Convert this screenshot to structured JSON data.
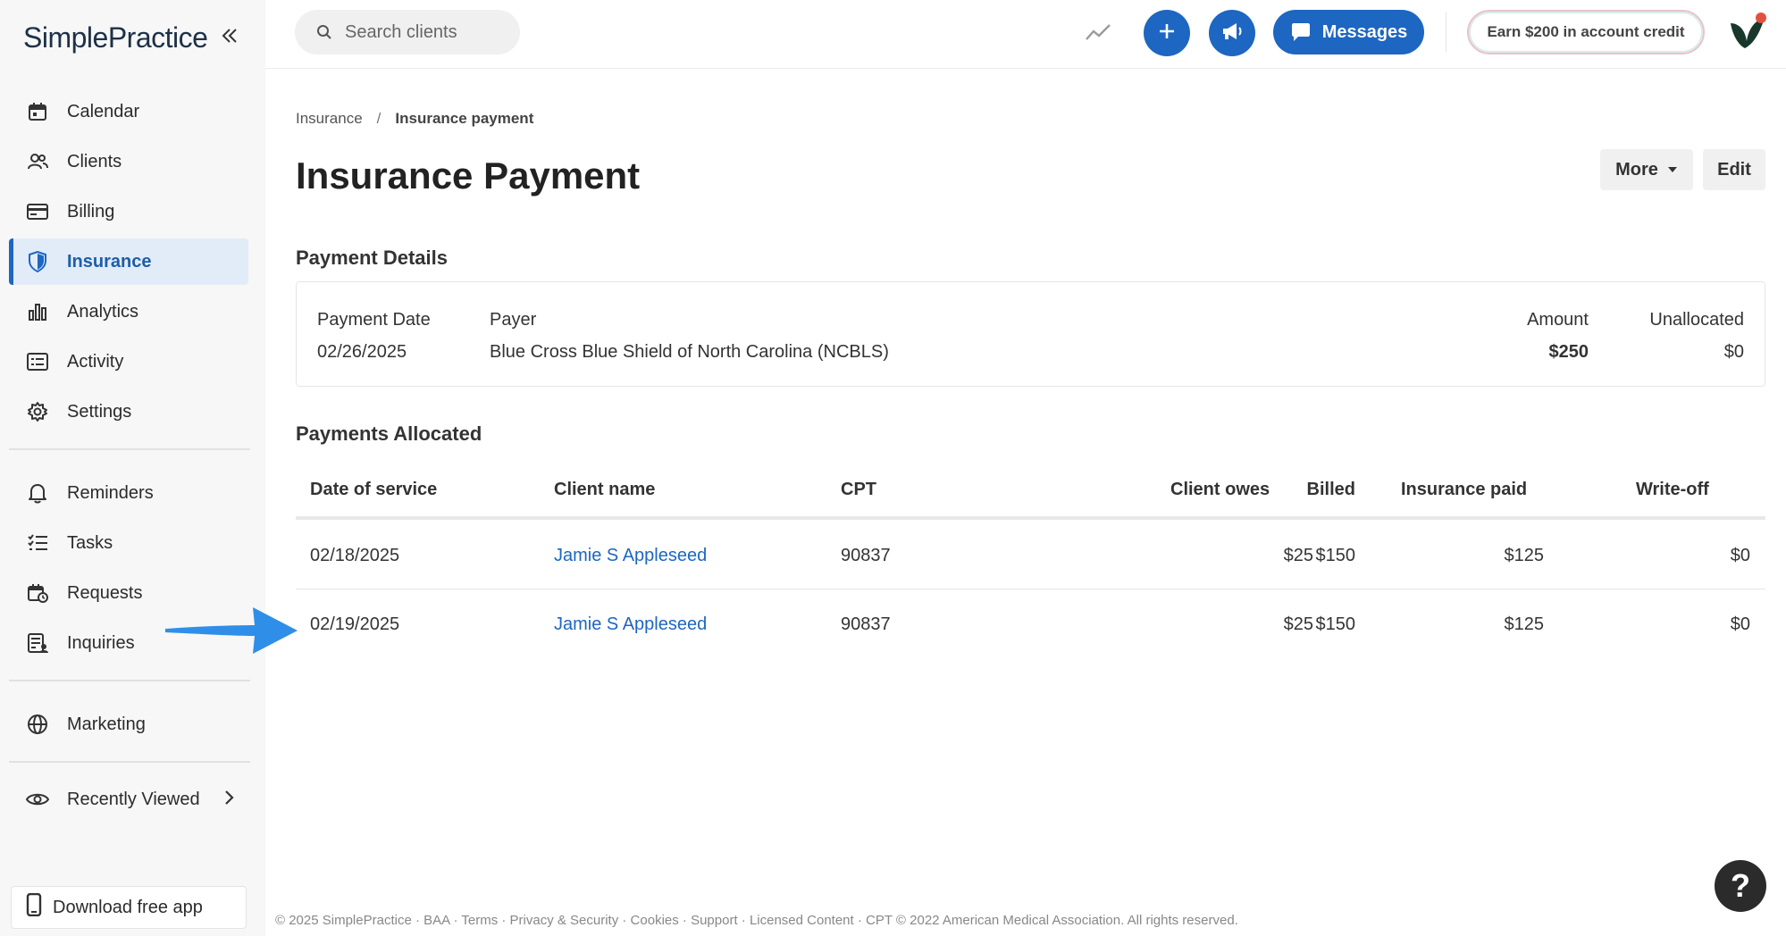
{
  "app": {
    "logo_text": "SimplePractice"
  },
  "sidebar": {
    "primary": [
      {
        "label": "Calendar",
        "icon": "calendar-icon",
        "active": false
      },
      {
        "label": "Clients",
        "icon": "clients-icon",
        "active": false
      },
      {
        "label": "Billing",
        "icon": "billing-icon",
        "active": false
      },
      {
        "label": "Insurance",
        "icon": "shield-icon",
        "active": true
      },
      {
        "label": "Analytics",
        "icon": "bar-chart-icon",
        "active": false
      },
      {
        "label": "Activity",
        "icon": "list-icon",
        "active": false
      },
      {
        "label": "Settings",
        "icon": "gear-icon",
        "active": false
      }
    ],
    "secondary": [
      {
        "label": "Reminders",
        "icon": "bell-icon"
      },
      {
        "label": "Tasks",
        "icon": "tasks-icon"
      },
      {
        "label": "Requests",
        "icon": "requests-icon"
      },
      {
        "label": "Inquiries",
        "icon": "inquiries-icon"
      }
    ],
    "marketing": {
      "label": "Marketing",
      "icon": "globe-icon"
    },
    "recently_viewed": {
      "label": "Recently Viewed",
      "icon": "eye-icon"
    },
    "download": {
      "label": "Download free app",
      "icon": "phone-icon"
    }
  },
  "topbar": {
    "search_placeholder": "Search clients",
    "messages_label": "Messages",
    "earn_label": "Earn $200 in account credit"
  },
  "breadcrumb": {
    "parent": "Insurance",
    "separator": "/",
    "current": "Insurance payment"
  },
  "page": {
    "title": "Insurance Payment",
    "more_label": "More",
    "edit_label": "Edit"
  },
  "payment_details": {
    "section_title": "Payment Details",
    "headers": {
      "date": "Payment Date",
      "payer": "Payer",
      "amount": "Amount",
      "unallocated": "Unallocated"
    },
    "values": {
      "date": "02/26/2025",
      "payer": "Blue Cross Blue Shield of North Carolina (NCBLS)",
      "amount": "$250",
      "unallocated": "$0"
    }
  },
  "payments_allocated": {
    "section_title": "Payments Allocated",
    "headers": {
      "date": "Date of service",
      "client": "Client name",
      "cpt": "CPT",
      "billed": "Billed",
      "client_owes": "Client owes",
      "insurance_paid": "Insurance paid",
      "write_off": "Write-off"
    },
    "rows": [
      {
        "date": "02/18/2025",
        "client": "Jamie S Appleseed",
        "cpt": "90837",
        "billed": "$150",
        "client_owes": "$25",
        "insurance_paid": "$125",
        "write_off": "$0"
      },
      {
        "date": "02/19/2025",
        "client": "Jamie S Appleseed",
        "cpt": "90837",
        "billed": "$150",
        "client_owes": "$25",
        "insurance_paid": "$125",
        "write_off": "$0"
      }
    ]
  },
  "footer": {
    "text": "© 2025 SimplePractice · BAA · Terms · Privacy & Security · Cookies · Support · Licensed Content · CPT © 2022 American Medical Association. All rights reserved."
  },
  "help": {
    "label": "?"
  },
  "colors": {
    "accent": "#1d66c2",
    "active_bg": "#e2ecf8",
    "link": "#1d66c2",
    "arrow": "#2f8fe8"
  }
}
